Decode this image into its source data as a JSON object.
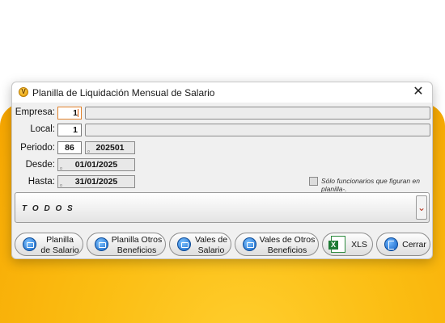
{
  "window": {
    "title": "Planilla de Liquidación Mensual de Salario",
    "icon": "app-logo-icon",
    "close_glyph": "✕"
  },
  "form": {
    "empresa": {
      "label": "Empresa:",
      "value": "1",
      "name": ""
    },
    "local": {
      "label": "Local:",
      "value": "1",
      "name": ""
    },
    "periodo": {
      "label": "Periodo:",
      "value": "86",
      "code": "202501"
    },
    "desde": {
      "label": "Desde:",
      "value": "01/01/2025"
    },
    "hasta": {
      "label": "Hasta:",
      "value": "31/01/2025"
    },
    "solo_funcionarios": {
      "label": "Sólo funcionarios que figuran en planilla-.",
      "checked": false
    }
  },
  "selector": {
    "value": "T O D O S",
    "arrow": "⌄"
  },
  "buttons": {
    "planilla_salario": {
      "line1": "Planilla",
      "line2": "de Salario"
    },
    "planilla_otros": {
      "line1": "Planilla Otros",
      "line2": "Beneficios"
    },
    "vales_salario": {
      "line1": "Vales de",
      "line2": "Salario"
    },
    "vales_otros": {
      "line1": "Vales de Otros",
      "line2": "Beneficios"
    },
    "xls": {
      "label": "XLS"
    },
    "cerrar": {
      "label": "Cerrar"
    }
  },
  "colors": {
    "background_accent": "#fbbd12",
    "window_bg": "#f0f0f0",
    "focus_border": "#e0812b",
    "icon_blue": "#1566c8",
    "excel_green": "#1e7b35"
  }
}
